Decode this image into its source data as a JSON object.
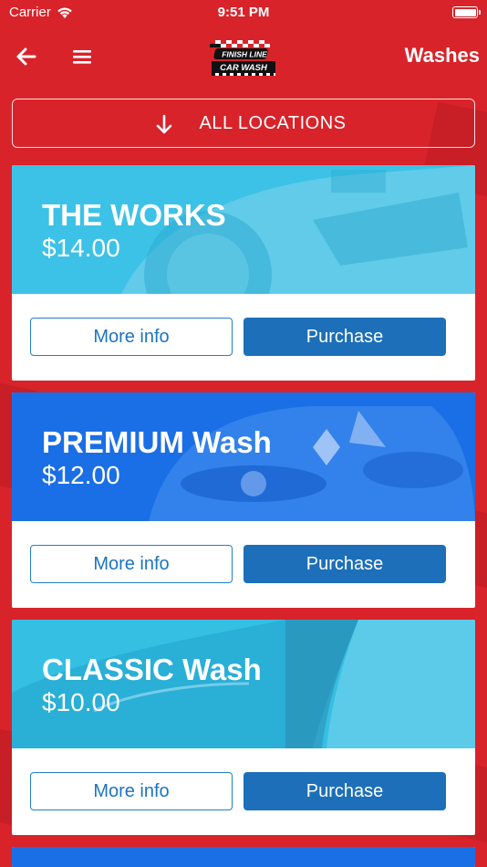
{
  "status_bar": {
    "carrier": "Carrier",
    "time": "9:51 PM"
  },
  "nav": {
    "title": "Washes",
    "logo_text_top": "FINISH LINE",
    "logo_text_bottom": "CAR WASH"
  },
  "location_selector": {
    "label": "ALL LOCATIONS"
  },
  "washes": [
    {
      "name": "THE WORKS",
      "price": "$14.00",
      "more_label": "More info",
      "buy_label": "Purchase",
      "hero_color": "#3cc2e6"
    },
    {
      "name": "PREMIUM Wash",
      "price": "$12.00",
      "more_label": "More info",
      "buy_label": "Purchase",
      "hero_color": "#1a6fe6"
    },
    {
      "name": "CLASSIC Wash",
      "price": "$10.00",
      "more_label": "More info",
      "buy_label": "Purchase",
      "hero_color": "#35bfe3"
    }
  ],
  "colors": {
    "brand_red": "#d8232a",
    "primary_blue": "#1c6fb8",
    "outline_blue": "#2180c8"
  }
}
